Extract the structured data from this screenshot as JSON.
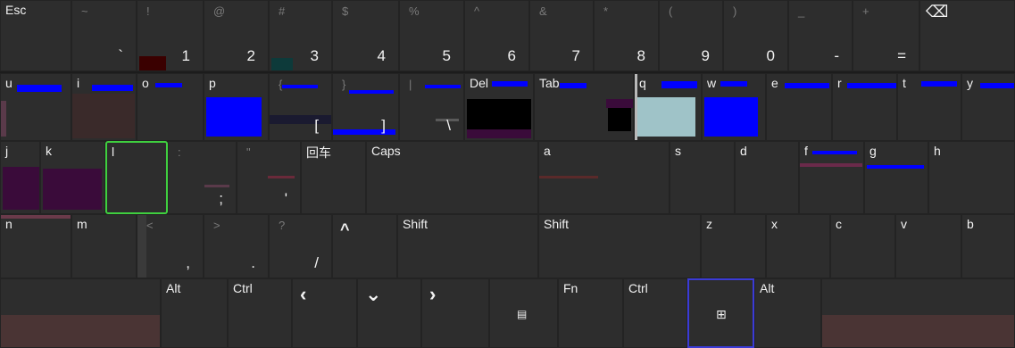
{
  "rows": [
    [
      {
        "id": "esc",
        "main": "Esc",
        "pos": "tl"
      },
      {
        "id": "backtick",
        "shift": "~",
        "main": "`"
      },
      {
        "id": "1",
        "shift": "!",
        "main": "1"
      },
      {
        "id": "2",
        "shift": "@",
        "main": "2"
      },
      {
        "id": "3",
        "shift": "#",
        "main": "3"
      },
      {
        "id": "4",
        "shift": "$",
        "main": "4"
      },
      {
        "id": "5",
        "shift": "%",
        "main": "5"
      },
      {
        "id": "6",
        "shift": "^",
        "main": "6"
      },
      {
        "id": "7",
        "shift": "&",
        "main": "7"
      },
      {
        "id": "8",
        "shift": "*",
        "main": "8"
      },
      {
        "id": "9",
        "shift": "(",
        "main": "9"
      },
      {
        "id": "0",
        "shift": ")",
        "main": "0"
      },
      {
        "id": "minus",
        "shift": "_",
        "main": "-"
      },
      {
        "id": "equals",
        "shift": "+",
        "main": "="
      },
      {
        "id": "backspace",
        "icon": "backspace-icon",
        "iconGlyph": "⌫"
      }
    ],
    [
      {
        "id": "u",
        "main": "u",
        "pos": "tl"
      },
      {
        "id": "i",
        "main": "i",
        "pos": "tl"
      },
      {
        "id": "o",
        "main": "o",
        "pos": "tl"
      },
      {
        "id": "p",
        "main": "p",
        "pos": "tl"
      },
      {
        "id": "lbracket",
        "shift": "{",
        "main": "["
      },
      {
        "id": "rbracket",
        "shift": "}",
        "main": "]"
      },
      {
        "id": "backslash",
        "shift": "|",
        "main": "\\"
      },
      {
        "id": "del",
        "main": "Del",
        "pos": "tl"
      },
      {
        "id": "tab",
        "main": "Tab",
        "pos": "tl"
      },
      {
        "id": "q",
        "main": "q",
        "pos": "tl"
      },
      {
        "id": "w",
        "main": "w",
        "pos": "tl"
      },
      {
        "id": "e",
        "main": "e",
        "pos": "tl"
      },
      {
        "id": "r",
        "main": "r",
        "pos": "tl"
      },
      {
        "id": "t",
        "main": "t",
        "pos": "tl"
      },
      {
        "id": "y",
        "main": "y",
        "pos": "tl"
      }
    ],
    [
      {
        "id": "j",
        "main": "j",
        "pos": "tl"
      },
      {
        "id": "k",
        "main": "k",
        "pos": "tl"
      },
      {
        "id": "l",
        "main": "l",
        "pos": "tl",
        "selected": true
      },
      {
        "id": "semicolon",
        "shift": ":",
        "main": ";"
      },
      {
        "id": "quote",
        "shift": "\"",
        "main": "'"
      },
      {
        "id": "enter",
        "main": "回车",
        "pos": "tl"
      },
      {
        "id": "caps",
        "main": "Caps",
        "pos": "tl"
      },
      {
        "id": "a",
        "main": "a",
        "pos": "tl"
      },
      {
        "id": "s",
        "main": "s",
        "pos": "tl"
      },
      {
        "id": "d",
        "main": "d",
        "pos": "tl"
      },
      {
        "id": "f",
        "main": "f",
        "pos": "tl"
      },
      {
        "id": "g",
        "main": "g",
        "pos": "tl"
      },
      {
        "id": "h",
        "main": "h",
        "pos": "tl"
      }
    ],
    [
      {
        "id": "n",
        "main": "n",
        "pos": "tl"
      },
      {
        "id": "m",
        "main": "m",
        "pos": "tl"
      },
      {
        "id": "comma",
        "shift": "<",
        "main": ","
      },
      {
        "id": "period",
        "shift": ">",
        "main": "."
      },
      {
        "id": "slash",
        "shift": "?",
        "main": "/"
      },
      {
        "id": "up",
        "icon": "arrow-up-icon",
        "iconGlyph": "^"
      },
      {
        "id": "shift-right",
        "main": "Shift",
        "pos": "tl"
      },
      {
        "id": "shift-left",
        "main": "Shift",
        "pos": "tl"
      },
      {
        "id": "z",
        "main": "z",
        "pos": "tl"
      },
      {
        "id": "x",
        "main": "x",
        "pos": "tl"
      },
      {
        "id": "c",
        "main": "c",
        "pos": "tl"
      },
      {
        "id": "v",
        "main": "v",
        "pos": "tl"
      },
      {
        "id": "b",
        "main": "b",
        "pos": "tl"
      }
    ],
    [
      {
        "id": "space-right",
        "main": ""
      },
      {
        "id": "alt-right",
        "main": "Alt",
        "pos": "tl"
      },
      {
        "id": "ctrl-right",
        "main": "Ctrl",
        "pos": "tl"
      },
      {
        "id": "left",
        "icon": "arrow-left-icon",
        "iconGlyph": "‹"
      },
      {
        "id": "down",
        "icon": "arrow-down-icon",
        "iconGlyph": "⌄"
      },
      {
        "id": "right",
        "icon": "arrow-right-icon",
        "iconGlyph": "›"
      },
      {
        "id": "menu",
        "icon": "menu-key-icon",
        "iconGlyph": "▤"
      },
      {
        "id": "fn",
        "main": "Fn",
        "pos": "tl"
      },
      {
        "id": "ctrl-left",
        "main": "Ctrl",
        "pos": "tl"
      },
      {
        "id": "win",
        "icon": "windows-icon",
        "iconGlyph": "⊞"
      },
      {
        "id": "alt-left",
        "main": "Alt",
        "pos": "tl"
      },
      {
        "id": "space-left",
        "main": ""
      }
    ]
  ],
  "colors": {
    "key_bg": "#2d2d2d",
    "selection_border": "#3fcf3f",
    "glitch_blue": "#0000ff",
    "glitch_teal": "#9fc3c8",
    "glitch_purple": "#3a0b3a"
  }
}
